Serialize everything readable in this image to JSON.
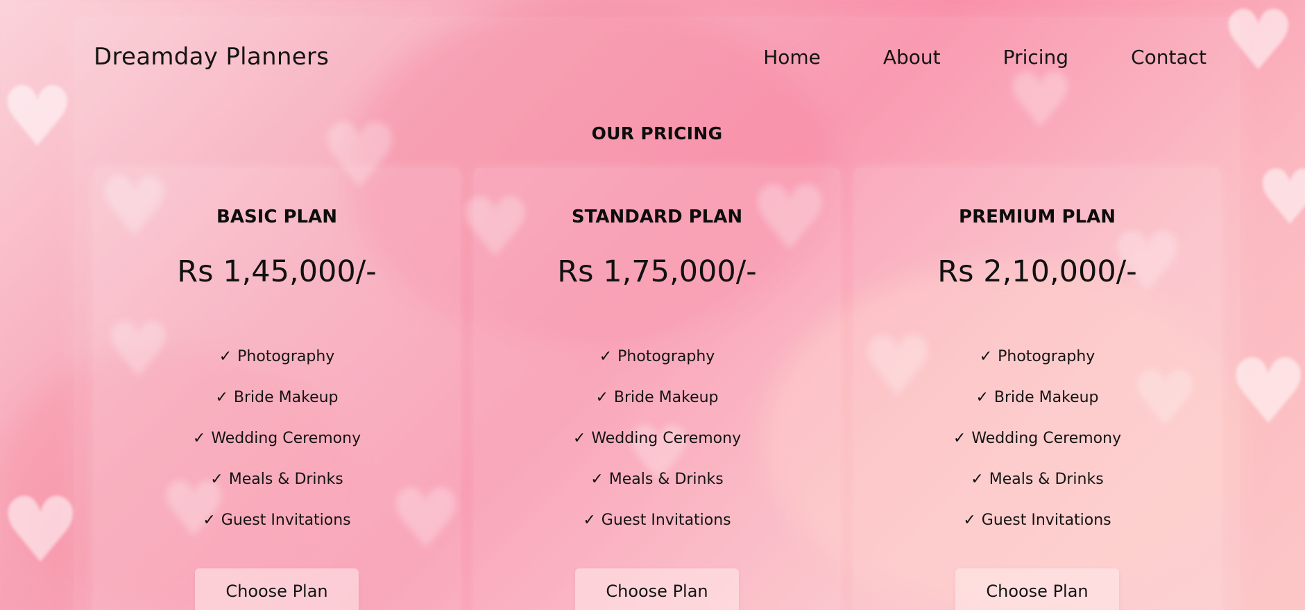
{
  "brand": "Dreamday Planners",
  "nav": [
    "Home",
    "About",
    "Pricing",
    "Contact"
  ],
  "section_title": "OUR PRICING",
  "plans": [
    {
      "title": "BASIC PLAN",
      "price": "Rs 1,45,000/-",
      "features": [
        "Photography",
        "Bride Makeup",
        "Wedding Ceremony",
        "Meals & Drinks",
        "Guest Invitations"
      ],
      "button": "Choose Plan"
    },
    {
      "title": "STANDARD PLAN",
      "price": "Rs 1,75,000/-",
      "features": [
        "Photography",
        "Bride Makeup",
        "Wedding Ceremony",
        "Meals & Drinks",
        "Guest Invitations"
      ],
      "button": "Choose Plan"
    },
    {
      "title": "PREMIUM PLAN",
      "price": "Rs 2,10,000/-",
      "features": [
        "Photography",
        "Bride Makeup",
        "Wedding Ceremony",
        "Meals & Drinks",
        "Guest Invitations"
      ],
      "button": "Choose Plan"
    }
  ],
  "icons": {
    "feature_check": "check-icon",
    "background": "heart-icon"
  },
  "colors": {
    "background_pink": "#f98fa9",
    "background_light": "#fbd3da",
    "text": "#111111"
  }
}
